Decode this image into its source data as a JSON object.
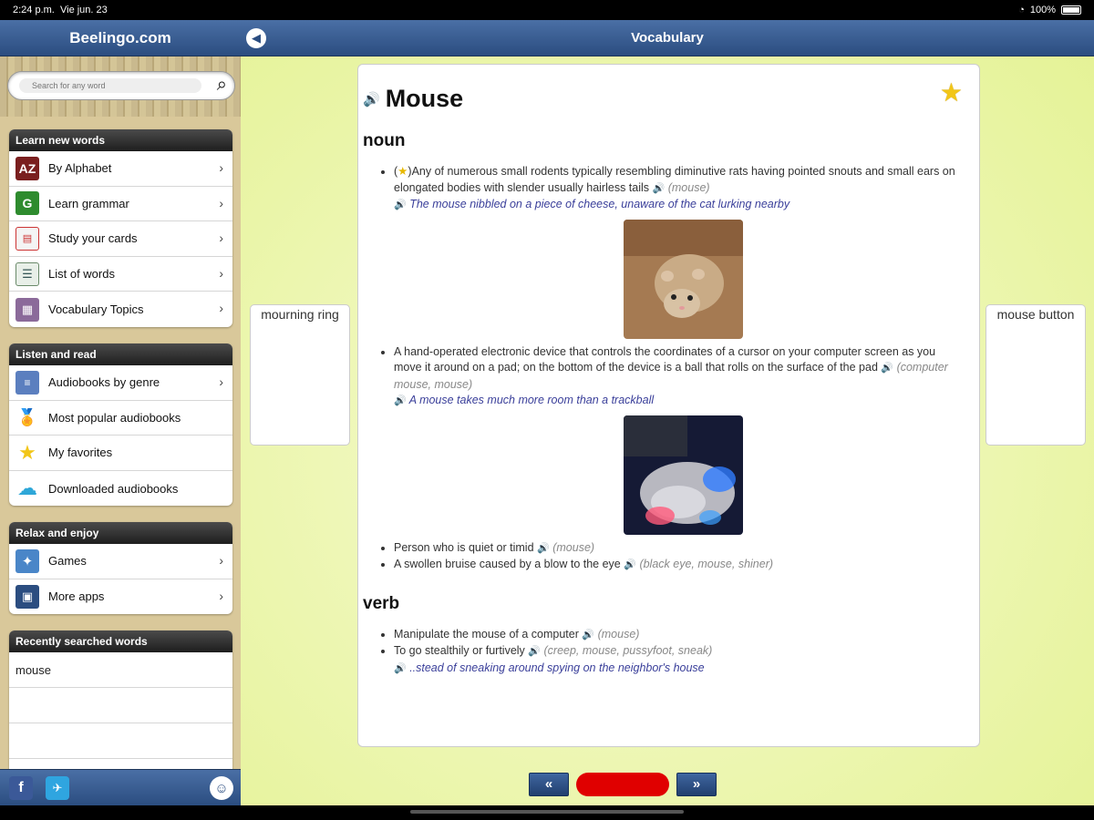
{
  "status": {
    "time": "2:24 p.m.",
    "date": "Vie jun. 23",
    "battery": "100%"
  },
  "sidebar": {
    "title": "Beelingo.com",
    "search_placeholder": "Search for any word",
    "sections": [
      {
        "heading": "Learn new words",
        "items": [
          {
            "label": "By Alphabet",
            "icon": "alphabet-icon"
          },
          {
            "label": "Learn grammar",
            "icon": "grammar-icon"
          },
          {
            "label": "Study your cards",
            "icon": "cards-icon"
          },
          {
            "label": "List of words",
            "icon": "list-icon"
          },
          {
            "label": "Vocabulary Topics",
            "icon": "topics-icon"
          }
        ]
      },
      {
        "heading": "Listen and read",
        "items": [
          {
            "label": "Audiobooks by genre",
            "icon": "books-icon"
          },
          {
            "label": "Most popular audiobooks",
            "icon": "medal-icon"
          },
          {
            "label": "My favorites",
            "icon": "star-icon"
          },
          {
            "label": "Downloaded audiobooks",
            "icon": "cloud-download-icon"
          }
        ]
      },
      {
        "heading": "Relax and enjoy",
        "items": [
          {
            "label": "Games",
            "icon": "puzzle-icon"
          },
          {
            "label": "More apps",
            "icon": "apps-icon"
          }
        ]
      }
    ],
    "recent": {
      "heading": "Recently searched words",
      "items": [
        "mouse"
      ]
    }
  },
  "main": {
    "title": "Vocabulary",
    "prev_word": "mourning ring",
    "next_word": "mouse button",
    "entry": {
      "word": "Mouse",
      "noun_label": "noun",
      "verb_label": "verb",
      "noun": [
        {
          "star_prefix": "(",
          "star_suffix": ")",
          "text": "Any of numerous small rodents typically resembling diminutive rats having pointed snouts and small ears on elongated bodies with slender usually hairless tails",
          "syn": "mouse",
          "example": "The mouse nibbled on a piece of cheese, unaware of the cat lurking nearby"
        },
        {
          "text": "A hand-operated electronic device that controls the coordinates of a cursor on your computer screen as you move it around on a pad; on the bottom of the device is a ball that rolls on the surface of the pad",
          "syn": "computer mouse, mouse",
          "example": "A mouse takes much more room than a trackball"
        },
        {
          "text": "Person who is quiet or timid",
          "syn": "mouse"
        },
        {
          "text": "A swollen bruise caused by a blow to the eye",
          "syn": "black eye, mouse, shiner"
        }
      ],
      "verb": [
        {
          "text": "Manipulate the mouse of a computer",
          "syn": "mouse"
        },
        {
          "text": "To go stealthily or furtively",
          "syn": "creep, mouse, pussyfoot, sneak",
          "example": "..stead of sneaking around spying on the neighbor's house"
        }
      ]
    },
    "nav": {
      "prev": "«",
      "next": "»"
    }
  },
  "colors": {
    "header_blue": "#2b4d80",
    "example_text": "#3a3f9a",
    "red_button": "#e00000",
    "background_green": "#e4f294"
  }
}
